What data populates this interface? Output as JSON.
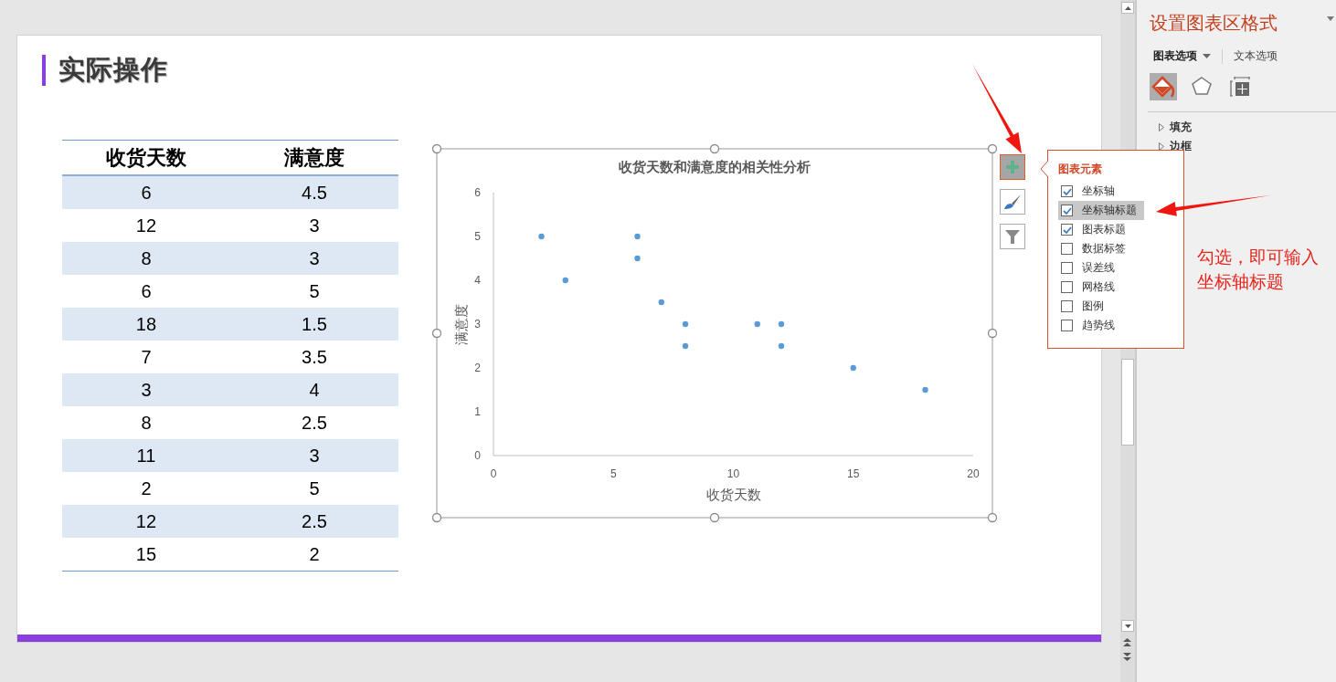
{
  "slide": {
    "title": "实际操作",
    "table": {
      "columns": [
        "收货天数",
        "满意度"
      ],
      "rows": [
        [
          "6",
          "4.5"
        ],
        [
          "12",
          "3"
        ],
        [
          "8",
          "3"
        ],
        [
          "6",
          "5"
        ],
        [
          "18",
          "1.5"
        ],
        [
          "7",
          "3.5"
        ],
        [
          "3",
          "4"
        ],
        [
          "8",
          "2.5"
        ],
        [
          "11",
          "3"
        ],
        [
          "2",
          "5"
        ],
        [
          "12",
          "2.5"
        ],
        [
          "15",
          "2"
        ]
      ]
    },
    "chart": {
      "chart_data": {
        "type": "scatter",
        "title": "收货天数和满意度的相关性分析",
        "xlabel": "收货天数",
        "ylabel": "满意度",
        "x": [
          6,
          12,
          8,
          6,
          18,
          7,
          3,
          8,
          11,
          2,
          12,
          15
        ],
        "series": [
          {
            "color": "#5b9bd5",
            "values": [
              4.5,
              3,
              3,
              5,
              1.5,
              3.5,
              4,
              2.5,
              3,
              5,
              2.5,
              2
            ]
          }
        ],
        "xlim": [
          0,
          20
        ],
        "ylim": [
          0,
          6
        ],
        "xticks": [
          0,
          5,
          10,
          15,
          20
        ],
        "yticks": [
          0,
          1,
          2,
          3,
          4,
          5,
          6
        ]
      }
    },
    "chart_tools": [
      {
        "kind": "add",
        "selected": true
      },
      {
        "kind": "style",
        "selected": false
      },
      {
        "kind": "filter",
        "selected": false
      }
    ]
  },
  "chart_elements_popup": {
    "title": "图表元素",
    "items": [
      {
        "label": "坐标轴",
        "checked": true,
        "selected": false
      },
      {
        "label": "坐标轴标题",
        "checked": true,
        "selected": true
      },
      {
        "label": "图表标题",
        "checked": true,
        "selected": false
      },
      {
        "label": "数据标签",
        "checked": false,
        "selected": false
      },
      {
        "label": "误差线",
        "checked": false,
        "selected": false
      },
      {
        "label": "网格线",
        "checked": false,
        "selected": false
      },
      {
        "label": "图例",
        "checked": false,
        "selected": false
      },
      {
        "label": "趋势线",
        "checked": false,
        "selected": false
      }
    ]
  },
  "annotation": {
    "text": "勾选，即可输入坐标轴标题"
  },
  "format_pane": {
    "title": "设置图表区格式",
    "tabs": [
      {
        "label": "图表选项",
        "selected": true
      },
      {
        "label": "文本选项",
        "selected": false
      }
    ],
    "icon_tabs": [
      {
        "kind": "fill",
        "selected": true
      },
      {
        "kind": "effects",
        "selected": false
      },
      {
        "kind": "size",
        "selected": false
      }
    ],
    "sections": [
      {
        "label": "填充",
        "expanded": false
      },
      {
        "label": "边框",
        "expanded": false
      }
    ]
  }
}
